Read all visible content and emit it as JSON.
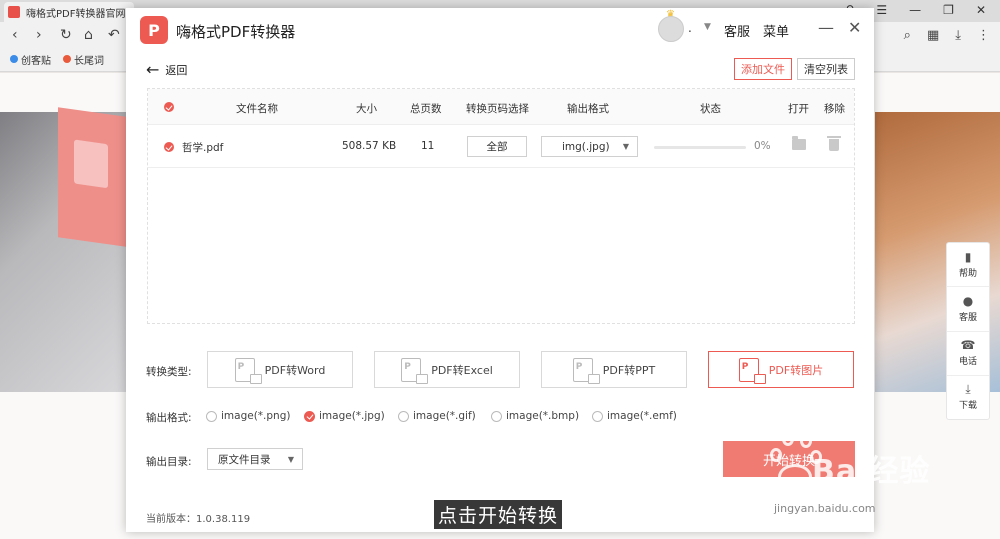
{
  "browser": {
    "tab_title": "嗨格式PDF转换器官网-提供",
    "bookmarks": [
      "创客贴",
      "长尾词"
    ],
    "side_tools": [
      {
        "icon": "book-icon",
        "label": "帮助"
      },
      {
        "icon": "headset-icon",
        "label": "客服"
      },
      {
        "icon": "phone-icon",
        "label": "电话"
      },
      {
        "icon": "download-icon",
        "label": "下载"
      }
    ]
  },
  "app": {
    "logo_letter": "P",
    "title": "嗨格式PDF转换器",
    "user_name": ".",
    "service_label": "客服",
    "menu_label": "菜单",
    "minimize_glyph": "—",
    "close_glyph": "✕",
    "back_label": "返回",
    "add_file_label": "添加文件",
    "clear_list_label": "清空列表"
  },
  "table": {
    "headers": {
      "name": "文件名称",
      "size": "大小",
      "pages": "总页数",
      "page_select": "转换页码选择",
      "output_format": "输出格式",
      "status": "状态",
      "open": "打开",
      "remove": "移除"
    },
    "rows": [
      {
        "name": "哲学.pdf",
        "size": "508.57 KB",
        "pages": "11",
        "page_select": "全部",
        "output_format": "img(.jpg)",
        "progress": 0,
        "progress_label": "0%"
      }
    ]
  },
  "options": {
    "type_label": "转换类型:",
    "types": [
      {
        "label": "PDF转Word",
        "active": false
      },
      {
        "label": "PDF转Excel",
        "active": false
      },
      {
        "label": "PDF转PPT",
        "active": false
      },
      {
        "label": "PDF转图片",
        "active": true
      }
    ],
    "format_label": "输出格式:",
    "formats": [
      {
        "label": "image(*.png)",
        "selected": false
      },
      {
        "label": "image(*.jpg)",
        "selected": true
      },
      {
        "label": "image(*.gif)",
        "selected": false
      },
      {
        "label": "image(*.bmp)",
        "selected": false
      },
      {
        "label": "image(*.emf)",
        "selected": false
      }
    ],
    "dir_label": "输出目录:",
    "dir_value": "原文件目录",
    "start_label": "开始转换"
  },
  "footer": {
    "version": "当前版本：1.0.38.119"
  },
  "overlay": {
    "subtitle": "点击开始转换",
    "watermark_text": "Bai经验",
    "watermark_url": "jingyan.baidu.com"
  },
  "colors": {
    "accent": "#ec5a52",
    "start_button": "#f07b72"
  }
}
